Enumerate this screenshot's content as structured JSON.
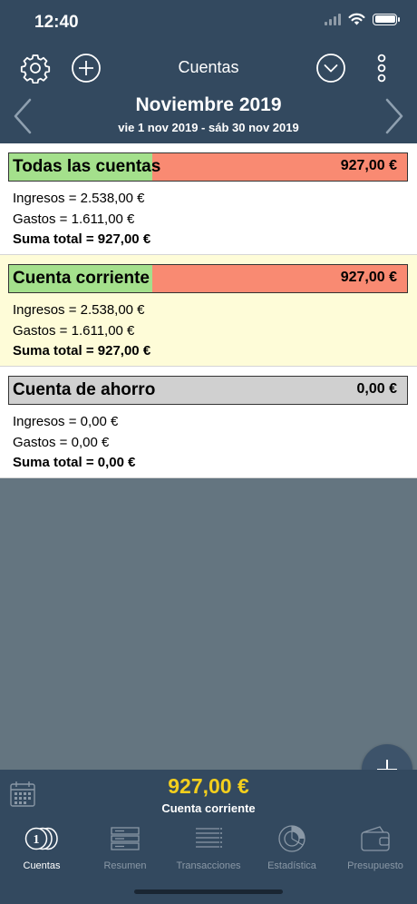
{
  "status_bar": {
    "time": "12:40"
  },
  "toolbar": {
    "title": "Cuentas"
  },
  "period": {
    "title": "Noviembre 2019",
    "range": "vie 1 nov 2019 - sáb 30 nov 2019"
  },
  "accounts": [
    {
      "name": "Todas las cuentas",
      "amount": "927,00 €",
      "income_line": "Ingresos = 2.538,00 €",
      "expenses_line": "Gastos = 1.611,00 €",
      "total_line": "Suma total = 927,00 €",
      "income_share": 0.36
    },
    {
      "name": "Cuenta corriente",
      "amount": "927,00 €",
      "income_line": "Ingresos = 2.538,00 €",
      "expenses_line": "Gastos = 1.611,00 €",
      "total_line": "Suma total = 927,00 €",
      "income_share": 0.36
    },
    {
      "name": "Cuenta de ahorro",
      "amount": "0,00 €",
      "income_line": "Ingresos = 0,00 €",
      "expenses_line": "Gastos = 0,00 €",
      "total_line": "Suma total = 0,00 €",
      "income_share": 0
    }
  ],
  "summary": {
    "amount": "927,00 €",
    "account": "Cuenta corriente"
  },
  "tabs": [
    {
      "label": "Cuentas",
      "icon": "coins-icon",
      "active": true
    },
    {
      "label": "Resumen",
      "icon": "summary-icon",
      "active": false
    },
    {
      "label": "Transacciones",
      "icon": "transactions-list-icon",
      "active": false
    },
    {
      "label": "Estadística",
      "icon": "statistics-icon",
      "active": false
    },
    {
      "label": "Presupuesto",
      "icon": "wallet-icon",
      "active": false
    }
  ],
  "colors": {
    "header": "#33495f",
    "income": "#a4e08c",
    "expenses": "#f98a72",
    "neutral": "#d0d0d0",
    "summary_amount": "#f3cf1d"
  }
}
